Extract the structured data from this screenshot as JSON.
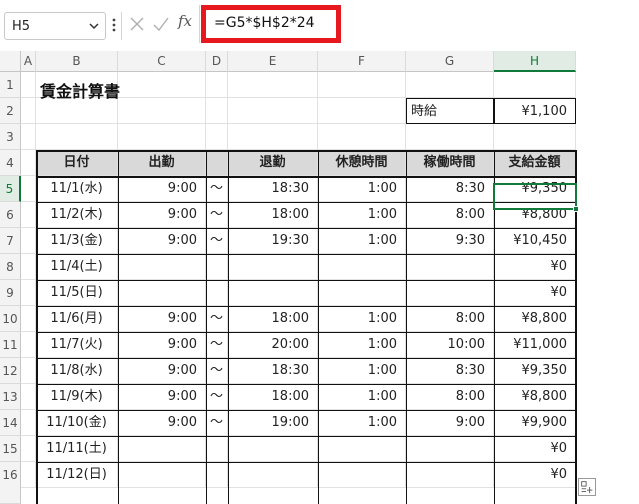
{
  "formula_bar": {
    "name_box": "H5",
    "fx_label": "fx",
    "formula": "=G5*$H$2*24"
  },
  "columns": [
    "A",
    "B",
    "C",
    "D",
    "E",
    "F",
    "G",
    "H"
  ],
  "rows": [
    "1",
    "2",
    "3",
    "4",
    "5",
    "6",
    "7",
    "8",
    "9",
    "10",
    "11",
    "12",
    "13",
    "14",
    "15",
    "16"
  ],
  "sheet": {
    "title": "賃金計算書",
    "wage_label": "時給",
    "wage_value": "¥1,100",
    "headers": {
      "date": "日付",
      "start": "出勤",
      "end": "退勤",
      "break": "休憩時間",
      "worked": "稼働時間",
      "pay": "支給金額"
    },
    "records": [
      {
        "date": "11/1(水)",
        "start": "9:00",
        "tilde": "〜",
        "end": "18:30",
        "break": "1:00",
        "worked": "8:30",
        "pay": "¥9,350"
      },
      {
        "date": "11/2(木)",
        "start": "9:00",
        "tilde": "〜",
        "end": "18:00",
        "break": "1:00",
        "worked": "8:00",
        "pay": "¥8,800"
      },
      {
        "date": "11/3(金)",
        "start": "9:00",
        "tilde": "〜",
        "end": "19:30",
        "break": "1:00",
        "worked": "9:30",
        "pay": "¥10,450"
      },
      {
        "date": "11/4(土)",
        "start": "",
        "tilde": "",
        "end": "",
        "break": "",
        "worked": "",
        "pay": "¥0"
      },
      {
        "date": "11/5(日)",
        "start": "",
        "tilde": "",
        "end": "",
        "break": "",
        "worked": "",
        "pay": "¥0"
      },
      {
        "date": "11/6(月)",
        "start": "9:00",
        "tilde": "〜",
        "end": "18:00",
        "break": "1:00",
        "worked": "8:00",
        "pay": "¥8,800"
      },
      {
        "date": "11/7(火)",
        "start": "9:00",
        "tilde": "〜",
        "end": "20:00",
        "break": "1:00",
        "worked": "10:00",
        "pay": "¥11,000"
      },
      {
        "date": "11/8(水)",
        "start": "9:00",
        "tilde": "〜",
        "end": "18:30",
        "break": "1:00",
        "worked": "8:30",
        "pay": "¥9,350"
      },
      {
        "date": "11/9(木)",
        "start": "9:00",
        "tilde": "〜",
        "end": "18:00",
        "break": "1:00",
        "worked": "8:00",
        "pay": "¥8,800"
      },
      {
        "date": "11/10(金)",
        "start": "9:00",
        "tilde": "〜",
        "end": "19:00",
        "break": "1:00",
        "worked": "9:00",
        "pay": "¥9,900"
      },
      {
        "date": "11/11(土)",
        "start": "",
        "tilde": "",
        "end": "",
        "break": "",
        "worked": "",
        "pay": "¥0"
      },
      {
        "date": "11/12(日)",
        "start": "",
        "tilde": "",
        "end": "",
        "break": "",
        "worked": "",
        "pay": "¥0"
      }
    ]
  },
  "colors": {
    "highlight": "#e8191e",
    "selection": "#117a3b",
    "header_fill": "#d9d9d9"
  },
  "icons": {
    "name_box_dropdown": "chevron-down-icon",
    "more": "vertical-dots-icon",
    "cancel": "x-icon",
    "enter": "checkmark-icon",
    "quick_analysis": "quick-analysis-icon"
  }
}
